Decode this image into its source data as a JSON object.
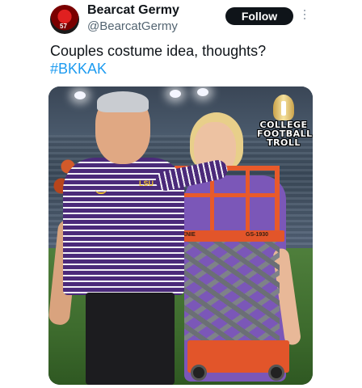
{
  "tweet": {
    "display_name": "Bearcat Germy",
    "handle": "@BearcatGermy",
    "follow_label": "Follow",
    "avatar_number": "57",
    "text": "Couples costume idea, thoughts?",
    "hashtag": "#BKKAK"
  },
  "media": {
    "logo_line1": "COLLEGE",
    "logo_line2": "FOOTBALL",
    "logo_line3": "TROLL",
    "shirt_logo": "LSU",
    "lift_label_left": "GENIE",
    "lift_label_right": "GS-1930"
  },
  "icons": {
    "more": "more-vertical-icon",
    "trophy": "trophy-icon"
  },
  "colors": {
    "follow_bg": "#0f1419",
    "hashtag": "#1d9bf0",
    "handle": "#536471"
  }
}
